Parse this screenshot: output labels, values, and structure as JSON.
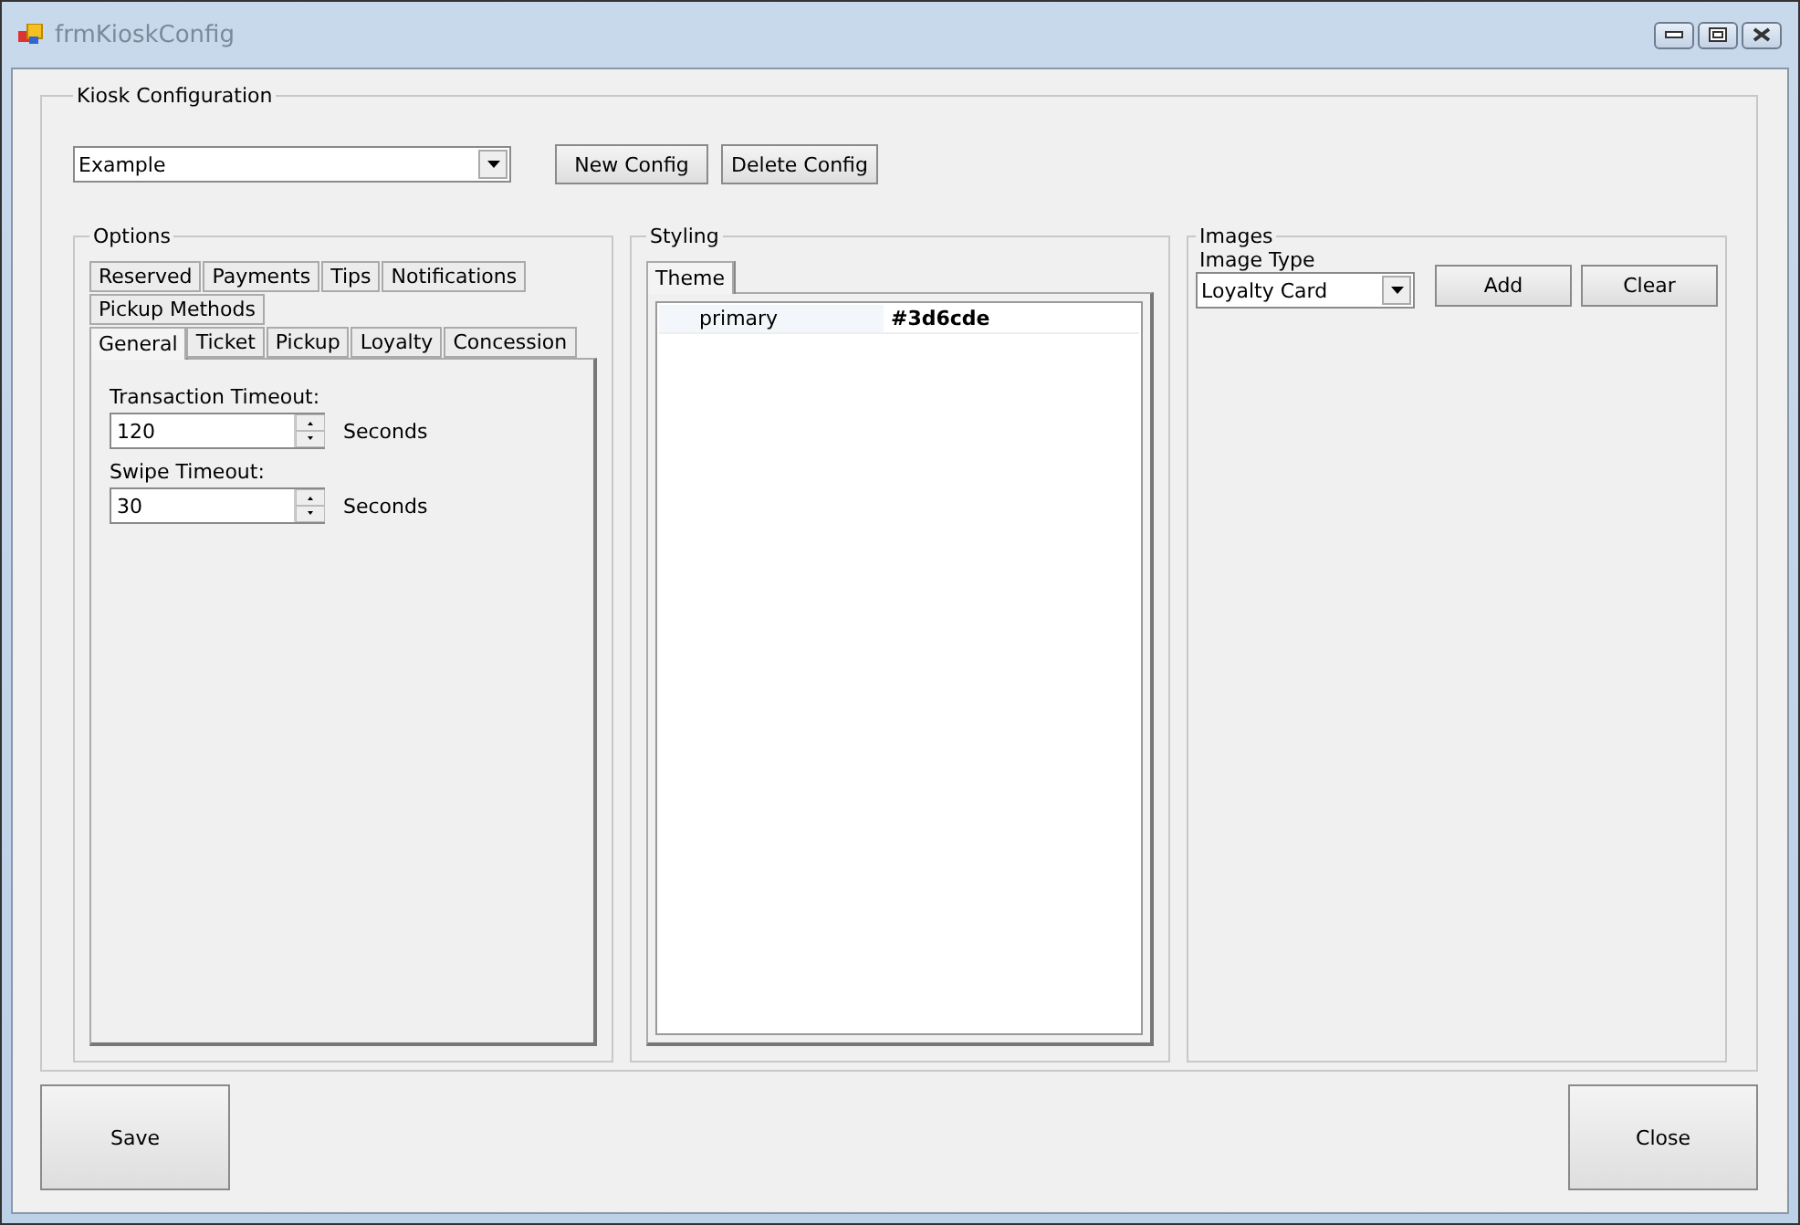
{
  "window": {
    "title": "frmKioskConfig"
  },
  "group": {
    "title": "Kiosk Configuration"
  },
  "config_select": {
    "value": "Example"
  },
  "config_buttons": [
    "New Config",
    "Delete Config"
  ],
  "options": {
    "title": "Options",
    "tab_rows": [
      [
        {
          "label": "Reserved",
          "selected": false
        },
        {
          "label": "Payments",
          "selected": false
        },
        {
          "label": "Tips",
          "selected": false
        },
        {
          "label": "Notifications",
          "selected": false
        }
      ],
      [
        {
          "label": "Pickup Methods",
          "selected": false
        }
      ],
      [
        {
          "label": "General",
          "selected": true
        },
        {
          "label": "Ticket",
          "selected": false
        },
        {
          "label": "Pickup",
          "selected": false
        },
        {
          "label": "Loyalty",
          "selected": false
        },
        {
          "label": "Concession",
          "selected": false
        }
      ]
    ],
    "fields": [
      {
        "label": "Transaction Timeout:",
        "value": "120",
        "unit": "Seconds"
      },
      {
        "label": "Swipe Timeout:",
        "value": "30",
        "unit": "Seconds"
      }
    ]
  },
  "styling": {
    "title": "Styling",
    "tabs": [
      {
        "label": "Theme",
        "selected": true
      }
    ],
    "properties": [
      {
        "name": "primary",
        "value": "#3d6cde"
      }
    ]
  },
  "images": {
    "title": "Images",
    "label": "Image Type",
    "select": {
      "value": "Loyalty Card"
    },
    "buttons": [
      "Add",
      "Clear"
    ]
  },
  "footer_buttons": [
    "Save",
    "Close"
  ]
}
